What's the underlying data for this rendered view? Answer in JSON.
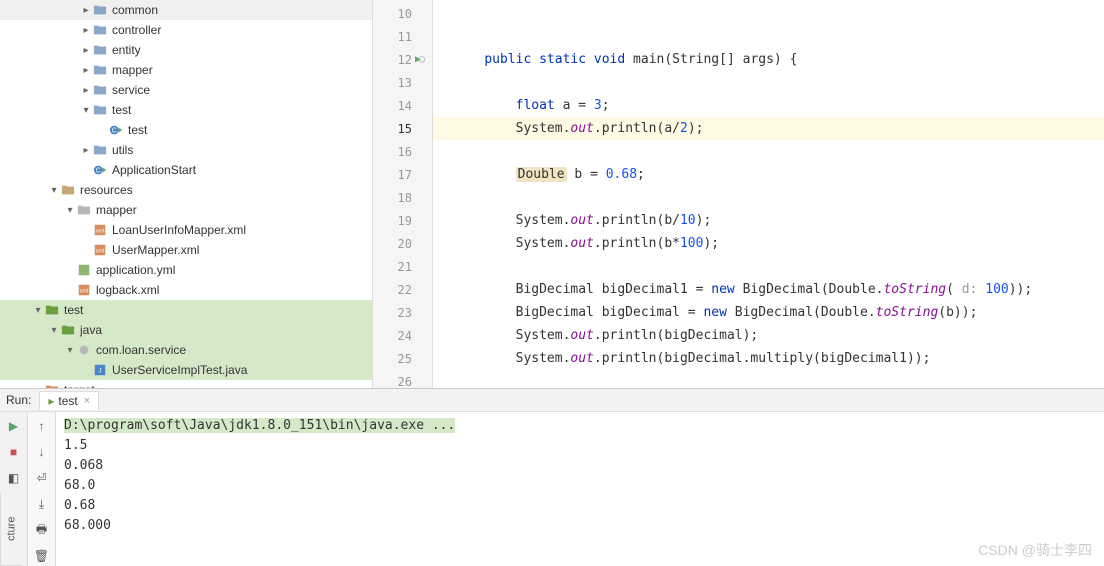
{
  "tree": [
    {
      "indent": 5,
      "chevron": ">",
      "icon": "folder",
      "label": "common"
    },
    {
      "indent": 5,
      "chevron": ">",
      "icon": "folder",
      "label": "controller"
    },
    {
      "indent": 5,
      "chevron": ">",
      "icon": "folder",
      "label": "entity"
    },
    {
      "indent": 5,
      "chevron": ">",
      "icon": "folder",
      "label": "mapper"
    },
    {
      "indent": 5,
      "chevron": ">",
      "icon": "folder",
      "label": "service"
    },
    {
      "indent": 5,
      "chevron": "v",
      "icon": "folder",
      "label": "test"
    },
    {
      "indent": 6,
      "chevron": "",
      "icon": "class-run",
      "label": "test"
    },
    {
      "indent": 5,
      "chevron": ">",
      "icon": "folder",
      "label": "utils"
    },
    {
      "indent": 5,
      "chevron": "",
      "icon": "class-run",
      "label": "ApplicationStart"
    },
    {
      "indent": 3,
      "chevron": "v",
      "icon": "resources",
      "label": "resources"
    },
    {
      "indent": 4,
      "chevron": "v",
      "icon": "folder-plain",
      "label": "mapper"
    },
    {
      "indent": 5,
      "chevron": "",
      "icon": "xml",
      "label": "LoanUserInfoMapper.xml"
    },
    {
      "indent": 5,
      "chevron": "",
      "icon": "xml",
      "label": "UserMapper.xml"
    },
    {
      "indent": 4,
      "chevron": "",
      "icon": "yml",
      "label": "application.yml"
    },
    {
      "indent": 4,
      "chevron": "",
      "icon": "xml",
      "label": "logback.xml"
    },
    {
      "indent": 2,
      "chevron": "v",
      "icon": "folder-test",
      "label": "test",
      "selected": true
    },
    {
      "indent": 3,
      "chevron": "v",
      "icon": "folder-test",
      "label": "java",
      "selected": true
    },
    {
      "indent": 4,
      "chevron": "v",
      "icon": "package",
      "label": "com.loan.service",
      "selected": true
    },
    {
      "indent": 5,
      "chevron": "",
      "icon": "java",
      "label": "UserServiceImplTest.java",
      "selected": true
    },
    {
      "indent": 2,
      "chevron": ">",
      "icon": "folder-excl",
      "label": "target"
    }
  ],
  "editor": {
    "lines": [
      {
        "n": 10,
        "tokens": []
      },
      {
        "n": 11,
        "tokens": []
      },
      {
        "n": 12,
        "run": true,
        "method": true,
        "tokens": [
          {
            "t": "    "
          },
          {
            "t": "public",
            "c": "kw"
          },
          {
            "t": " "
          },
          {
            "t": "static",
            "c": "kw"
          },
          {
            "t": " "
          },
          {
            "t": "void",
            "c": "kw"
          },
          {
            "t": " main(String[] args) {"
          }
        ]
      },
      {
        "n": 13,
        "tokens": []
      },
      {
        "n": 14,
        "tokens": [
          {
            "t": "        "
          },
          {
            "t": "float",
            "c": "kw"
          },
          {
            "t": " a = "
          },
          {
            "t": "3",
            "c": "num"
          },
          {
            "t": ";"
          }
        ]
      },
      {
        "n": 15,
        "hl": true,
        "tokens": [
          {
            "t": "        System."
          },
          {
            "t": "out",
            "c": "static-ref"
          },
          {
            "t": ".println(a/"
          },
          {
            "t": "2",
            "c": "num"
          },
          {
            "t": ");"
          }
        ]
      },
      {
        "n": 16,
        "tokens": []
      },
      {
        "n": 17,
        "tokens": [
          {
            "t": "        "
          },
          {
            "t": "Double",
            "c": "boxed"
          },
          {
            "t": " b = "
          },
          {
            "t": "0.68",
            "c": "num"
          },
          {
            "t": ";"
          }
        ]
      },
      {
        "n": 18,
        "tokens": []
      },
      {
        "n": 19,
        "tokens": [
          {
            "t": "        System."
          },
          {
            "t": "out",
            "c": "static-ref"
          },
          {
            "t": ".println(b/"
          },
          {
            "t": "10",
            "c": "num"
          },
          {
            "t": ");"
          }
        ]
      },
      {
        "n": 20,
        "tokens": [
          {
            "t": "        System."
          },
          {
            "t": "out",
            "c": "static-ref"
          },
          {
            "t": ".println(b*"
          },
          {
            "t": "100",
            "c": "num"
          },
          {
            "t": ");"
          }
        ]
      },
      {
        "n": 21,
        "tokens": []
      },
      {
        "n": 22,
        "tokens": [
          {
            "t": "        BigDecimal bigDecimal1 = "
          },
          {
            "t": "new",
            "c": "kw"
          },
          {
            "t": " BigDecimal(Double."
          },
          {
            "t": "toString",
            "c": "static-ref"
          },
          {
            "t": "( "
          },
          {
            "t": "d: ",
            "c": "str-hint"
          },
          {
            "t": "100",
            "c": "num"
          },
          {
            "t": "));"
          }
        ]
      },
      {
        "n": 23,
        "tokens": [
          {
            "t": "        BigDecimal bigDecimal = "
          },
          {
            "t": "new",
            "c": "kw"
          },
          {
            "t": " BigDecimal(Double."
          },
          {
            "t": "toString",
            "c": "static-ref"
          },
          {
            "t": "(b));"
          }
        ]
      },
      {
        "n": 24,
        "tokens": [
          {
            "t": "        System."
          },
          {
            "t": "out",
            "c": "static-ref"
          },
          {
            "t": ".println(bigDecimal);"
          }
        ]
      },
      {
        "n": 25,
        "tokens": [
          {
            "t": "        System."
          },
          {
            "t": "out",
            "c": "static-ref"
          },
          {
            "t": ".println(bigDecimal.multiply(bigDecimal1));"
          }
        ]
      },
      {
        "n": 26,
        "tokens": []
      }
    ]
  },
  "run": {
    "label": "Run:",
    "tab_name": "test",
    "command": "D:\\program\\soft\\Java\\jdk1.8.0_151\\bin\\java.exe ...",
    "output": [
      "1.5",
      "0.068",
      "68.0",
      "0.68",
      "68.000"
    ]
  },
  "structure_tab": "cture",
  "watermark": "CSDN @骑士李四"
}
